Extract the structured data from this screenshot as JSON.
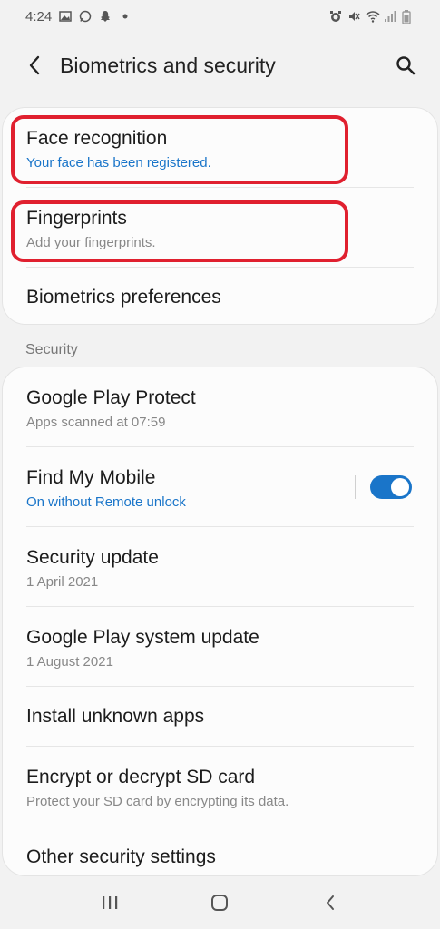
{
  "status_bar": {
    "time": "4:24",
    "icons_left": [
      "image-icon",
      "whatsapp-icon",
      "snapchat-icon",
      "dot-icon"
    ],
    "icons_right": [
      "alarm-icon",
      "mute-icon",
      "wifi-icon",
      "signal-icon",
      "battery-icon"
    ]
  },
  "header": {
    "title": "Biometrics and security"
  },
  "biometrics": {
    "items": [
      {
        "title": "Face recognition",
        "subtitle": "Your face has been registered."
      },
      {
        "title": "Fingerprints",
        "subtitle": "Add your fingerprints."
      },
      {
        "title": "Biometrics preferences"
      }
    ]
  },
  "security": {
    "section_label": "Security",
    "items": [
      {
        "title": "Google Play Protect",
        "subtitle": "Apps scanned at 07:59"
      },
      {
        "title": "Find My Mobile",
        "subtitle": "On without Remote unlock",
        "toggle_on": true
      },
      {
        "title": "Security update",
        "subtitle": "1 April 2021"
      },
      {
        "title": "Google Play system update",
        "subtitle": "1 August 2021"
      },
      {
        "title": "Install unknown apps"
      },
      {
        "title": "Encrypt or decrypt SD card",
        "subtitle": "Protect your SD card by encrypting its data."
      },
      {
        "title": "Other security settings"
      }
    ]
  },
  "colors": {
    "accent": "#1a75c9",
    "highlight": "#e0202f",
    "background": "#f2f2f2",
    "card": "#fcfcfc"
  }
}
